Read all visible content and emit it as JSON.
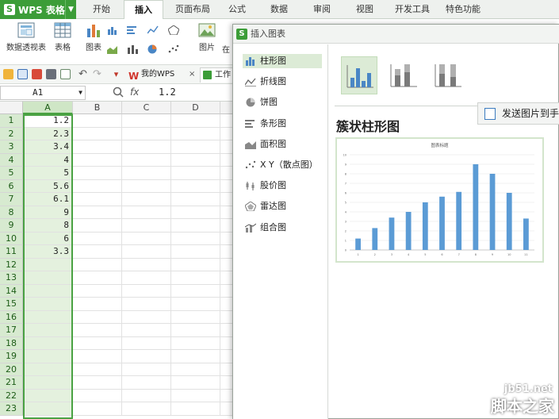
{
  "app": {
    "menu_label": "WPS 表格",
    "logo_glyph": "S",
    "accent": "#3c9d38"
  },
  "tabs": [
    {
      "label": "开始"
    },
    {
      "label": "插入",
      "active": true
    },
    {
      "label": "页面布局"
    },
    {
      "label": "公式"
    },
    {
      "label": "数据"
    },
    {
      "label": "审阅"
    },
    {
      "label": "视图"
    },
    {
      "label": "开发工具"
    },
    {
      "label": "特色功能"
    }
  ],
  "ribbon": {
    "pivot_label": "数据透视表",
    "table_label": "表格",
    "chart_label": "图表",
    "picture_label": "图片",
    "partial_label": "在"
  },
  "quickbar": {
    "doc_tab_1": "我的WPS",
    "doc_tab_close": "×",
    "doc_tab_2": "工作"
  },
  "formula": {
    "cell_ref": "A1",
    "fx_label": "fx",
    "value": "1.2"
  },
  "sheet": {
    "columns": [
      "A",
      "B",
      "C",
      "D"
    ],
    "rows": [
      "1",
      "2",
      "3",
      "4",
      "5",
      "6",
      "7",
      "8",
      "9",
      "10",
      "11",
      "12",
      "13",
      "14",
      "15",
      "16",
      "17",
      "18",
      "19",
      "20",
      "21",
      "22",
      "23"
    ],
    "col_a_values": [
      "1.2",
      "2.3",
      "3.4",
      "4",
      "5",
      "5.6",
      "6.1",
      "9",
      "8",
      "6",
      "3.3"
    ]
  },
  "dialog": {
    "title": "插入图表",
    "chart_types": [
      {
        "label": "柱形图",
        "icon": "column-chart-icon",
        "active": true
      },
      {
        "label": "折线图",
        "icon": "line-chart-icon"
      },
      {
        "label": "饼图",
        "icon": "pie-chart-icon"
      },
      {
        "label": "条形图",
        "icon": "bar-chart-icon"
      },
      {
        "label": "面积图",
        "icon": "area-chart-icon"
      },
      {
        "label": "X Y（散点图）",
        "icon": "scatter-chart-icon"
      },
      {
        "label": "股价图",
        "icon": "stock-chart-icon"
      },
      {
        "label": "雷达图",
        "icon": "radar-chart-icon"
      },
      {
        "label": "组合图",
        "icon": "combo-chart-icon"
      }
    ],
    "selected_subtype_title": "簇状柱形图",
    "send_button": "发送图片到手"
  },
  "chart_data": {
    "type": "bar",
    "title": "图表标题",
    "categories": [
      "1",
      "2",
      "3",
      "4",
      "5",
      "6",
      "7",
      "8",
      "9",
      "10",
      "11"
    ],
    "values": [
      1.2,
      2.3,
      3.4,
      4,
      5,
      5.6,
      6.1,
      9,
      8,
      6,
      3.3
    ],
    "ylim": [
      0,
      10
    ],
    "yticks": [
      "0",
      "1",
      "2",
      "3",
      "4",
      "5",
      "6",
      "7",
      "8",
      "9",
      "10"
    ],
    "bar_color": "#5b9bd5",
    "grid": true
  },
  "watermark": {
    "url": "jb51.net",
    "name": "脚本之家"
  }
}
